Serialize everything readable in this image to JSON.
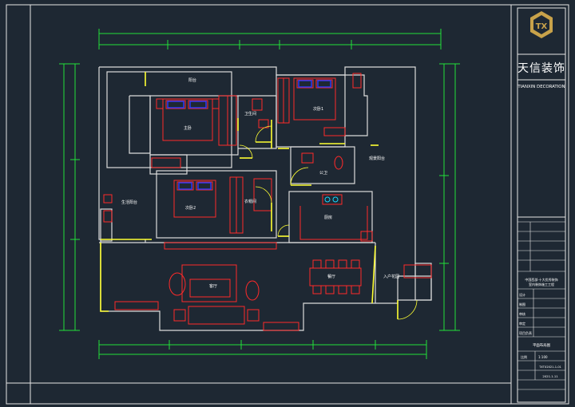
{
  "colors": {
    "background": "#1e2833",
    "frame": "#e6e6e6",
    "wall": "#dcdcdc",
    "furniture": "#ff2a2a",
    "door": "#ffff33",
    "dimension": "#22e03a",
    "accent_blue": "#2a3cff",
    "cyan": "#19d8ff",
    "logo_gold": "#c8a24a"
  },
  "title_block": {
    "logo_alt": "TX",
    "brand_cn": "天信装饰",
    "brand_en": "TIANXIN DECORATION",
    "project_line1": "中国西部·十大优秀装饰",
    "project_line2": "室内装饰施工工程",
    "row_labels": [
      "设计",
      "制图",
      "审核",
      "审定",
      "项目负责"
    ],
    "drawing_title": "平面布局图",
    "scale_label": "比例",
    "scale_value": "1:100",
    "drawing_no": "TXTX2021-1-01",
    "date": "2021.1.11"
  },
  "rooms": {
    "master_bedroom": "主卧",
    "bedroom_right": "次卧1",
    "bedroom_2": "次卧2",
    "closet": "衣帽间",
    "bath_1": "卫生间",
    "bath_2": "公卫",
    "kitchen": "厨房",
    "dining": "餐厅",
    "living": "客厅",
    "balcony_top": "阳台",
    "balcony_right": "观景阳台",
    "laundry": "生活阳台",
    "entrance": "入户花园"
  }
}
